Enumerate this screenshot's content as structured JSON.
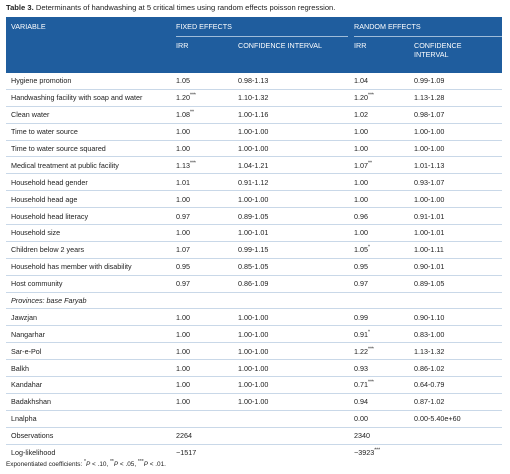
{
  "caption": {
    "label": "Table 3.",
    "text": " Determinants of handwashing at 5 critical times using random effects poisson regression."
  },
  "headers": {
    "variable": "VARIABLE",
    "fixed_effects": "FIXED EFFECTS",
    "random_effects": "RANDOM EFFECTS",
    "irr": "IRR",
    "ci": "CONFIDENCE INTERVAL",
    "ci_line1": "CONFIDENCE",
    "ci_line2": "INTERVAL"
  },
  "rows": [
    {
      "variable": "Hygiene promotion",
      "fe_irr": "1.05",
      "fe_sup": "",
      "fe_ci": "0.98-1.13",
      "re_irr": "1.04",
      "re_sup": "",
      "re_ci": "0.99-1.09"
    },
    {
      "variable": "Handwashing facility with soap and water",
      "fe_irr": "1.20",
      "fe_sup": "***",
      "fe_ci": "1.10-1.32",
      "re_irr": "1.20",
      "re_sup": "***",
      "re_ci": "1.13-1.28"
    },
    {
      "variable": "Clean water",
      "fe_irr": "1.08",
      "fe_sup": "**",
      "fe_ci": "1.00-1.16",
      "re_irr": "1.02",
      "re_sup": "",
      "re_ci": "0.98-1.07"
    },
    {
      "variable": "Time to water source",
      "fe_irr": "1.00",
      "fe_sup": "",
      "fe_ci": "1.00-1.00",
      "re_irr": "1.00",
      "re_sup": "",
      "re_ci": "1.00-1.00"
    },
    {
      "variable": "Time to water source squared",
      "fe_irr": "1.00",
      "fe_sup": "",
      "fe_ci": "1.00-1.00",
      "re_irr": "1.00",
      "re_sup": "",
      "re_ci": "1.00-1.00"
    },
    {
      "variable": "Medical treatment at public facility",
      "fe_irr": "1.13",
      "fe_sup": "***",
      "fe_ci": "1.04-1.21",
      "re_irr": "1.07",
      "re_sup": "**",
      "re_ci": "1.01-1.13"
    },
    {
      "variable": "Household head gender",
      "fe_irr": "1.01",
      "fe_sup": "",
      "fe_ci": "0.91-1.12",
      "re_irr": "1.00",
      "re_sup": "",
      "re_ci": "0.93-1.07"
    },
    {
      "variable": "Household head age",
      "fe_irr": "1.00",
      "fe_sup": "",
      "fe_ci": "1.00-1.00",
      "re_irr": "1.00",
      "re_sup": "",
      "re_ci": "1.00-1.00"
    },
    {
      "variable": "Household head literacy",
      "fe_irr": "0.97",
      "fe_sup": "",
      "fe_ci": "0.89-1.05",
      "re_irr": "0.96",
      "re_sup": "",
      "re_ci": "0.91-1.01"
    },
    {
      "variable": "Household size",
      "fe_irr": "1.00",
      "fe_sup": "",
      "fe_ci": "1.00-1.01",
      "re_irr": "1.00",
      "re_sup": "",
      "re_ci": "1.00-1.01"
    },
    {
      "variable": "Children below 2 years",
      "fe_irr": "1.07",
      "fe_sup": "",
      "fe_ci": "0.99-1.15",
      "re_irr": "1.05",
      "re_sup": "*",
      "re_ci": "1.00-1.11"
    },
    {
      "variable": "Household has member with disability",
      "fe_irr": "0.95",
      "fe_sup": "",
      "fe_ci": "0.85-1.05",
      "re_irr": "0.95",
      "re_sup": "",
      "re_ci": "0.90-1.01"
    },
    {
      "variable": "Host community",
      "fe_irr": "0.97",
      "fe_sup": "",
      "fe_ci": "0.86-1.09",
      "re_irr": "0.97",
      "re_sup": "",
      "re_ci": "0.89-1.05"
    },
    {
      "variable": "Provinces: base Faryab",
      "italic": true,
      "fe_irr": "",
      "fe_sup": "",
      "fe_ci": "",
      "re_irr": "",
      "re_sup": "",
      "re_ci": ""
    },
    {
      "variable": "Jawzjan",
      "fe_irr": "1.00",
      "fe_sup": "",
      "fe_ci": "1.00-1.00",
      "re_irr": "0.99",
      "re_sup": "",
      "re_ci": "0.90-1.10"
    },
    {
      "variable": "Nangarhar",
      "fe_irr": "1.00",
      "fe_sup": "",
      "fe_ci": "1.00-1.00",
      "re_irr": "0.91",
      "re_sup": "*",
      "re_ci": "0.83-1.00"
    },
    {
      "variable": "Sar-e-Pol",
      "fe_irr": "1.00",
      "fe_sup": "",
      "fe_ci": "1.00-1.00",
      "re_irr": "1.22",
      "re_sup": "***",
      "re_ci": "1.13-1.32"
    },
    {
      "variable": "Balkh",
      "fe_irr": "1.00",
      "fe_sup": "",
      "fe_ci": "1.00-1.00",
      "re_irr": "0.93",
      "re_sup": "",
      "re_ci": "0.86-1.02"
    },
    {
      "variable": "Kandahar",
      "fe_irr": "1.00",
      "fe_sup": "",
      "fe_ci": "1.00-1.00",
      "re_irr": "0.71",
      "re_sup": "***",
      "re_ci": "0.64-0.79"
    },
    {
      "variable": "Badakhshan",
      "fe_irr": "1.00",
      "fe_sup": "",
      "fe_ci": "1.00-1.00",
      "re_irr": "0.94",
      "re_sup": "",
      "re_ci": "0.87-1.02"
    },
    {
      "variable": "Lnalpha",
      "fe_irr": "",
      "fe_sup": "",
      "fe_ci": "",
      "re_irr": "0.00",
      "re_sup": "",
      "re_ci": "0.00-5.40e+60"
    },
    {
      "variable": "Observations",
      "fe_irr": "2264",
      "fe_sup": "",
      "fe_ci": "",
      "re_irr": "2340",
      "re_sup": "",
      "re_ci": ""
    },
    {
      "variable": "Log-likelihood",
      "fe_irr": "−1517",
      "fe_sup": "",
      "fe_ci": "",
      "re_irr": "−3923",
      "re_sup": "***",
      "re_ci": ""
    }
  ],
  "footnote": {
    "prefix": "Exponentiated coefficients: ",
    "s1": "*",
    "p1": "P",
    "t1": " < .10, ",
    "s2": "**",
    "p2": "P",
    "t2": " < .05, ",
    "s3": "***",
    "p3": "P",
    "t3": " < .01."
  },
  "colors": {
    "header_bg": "#1f5d9e",
    "header_text": "#ffffff",
    "row_divider": "#c9d8e8"
  }
}
